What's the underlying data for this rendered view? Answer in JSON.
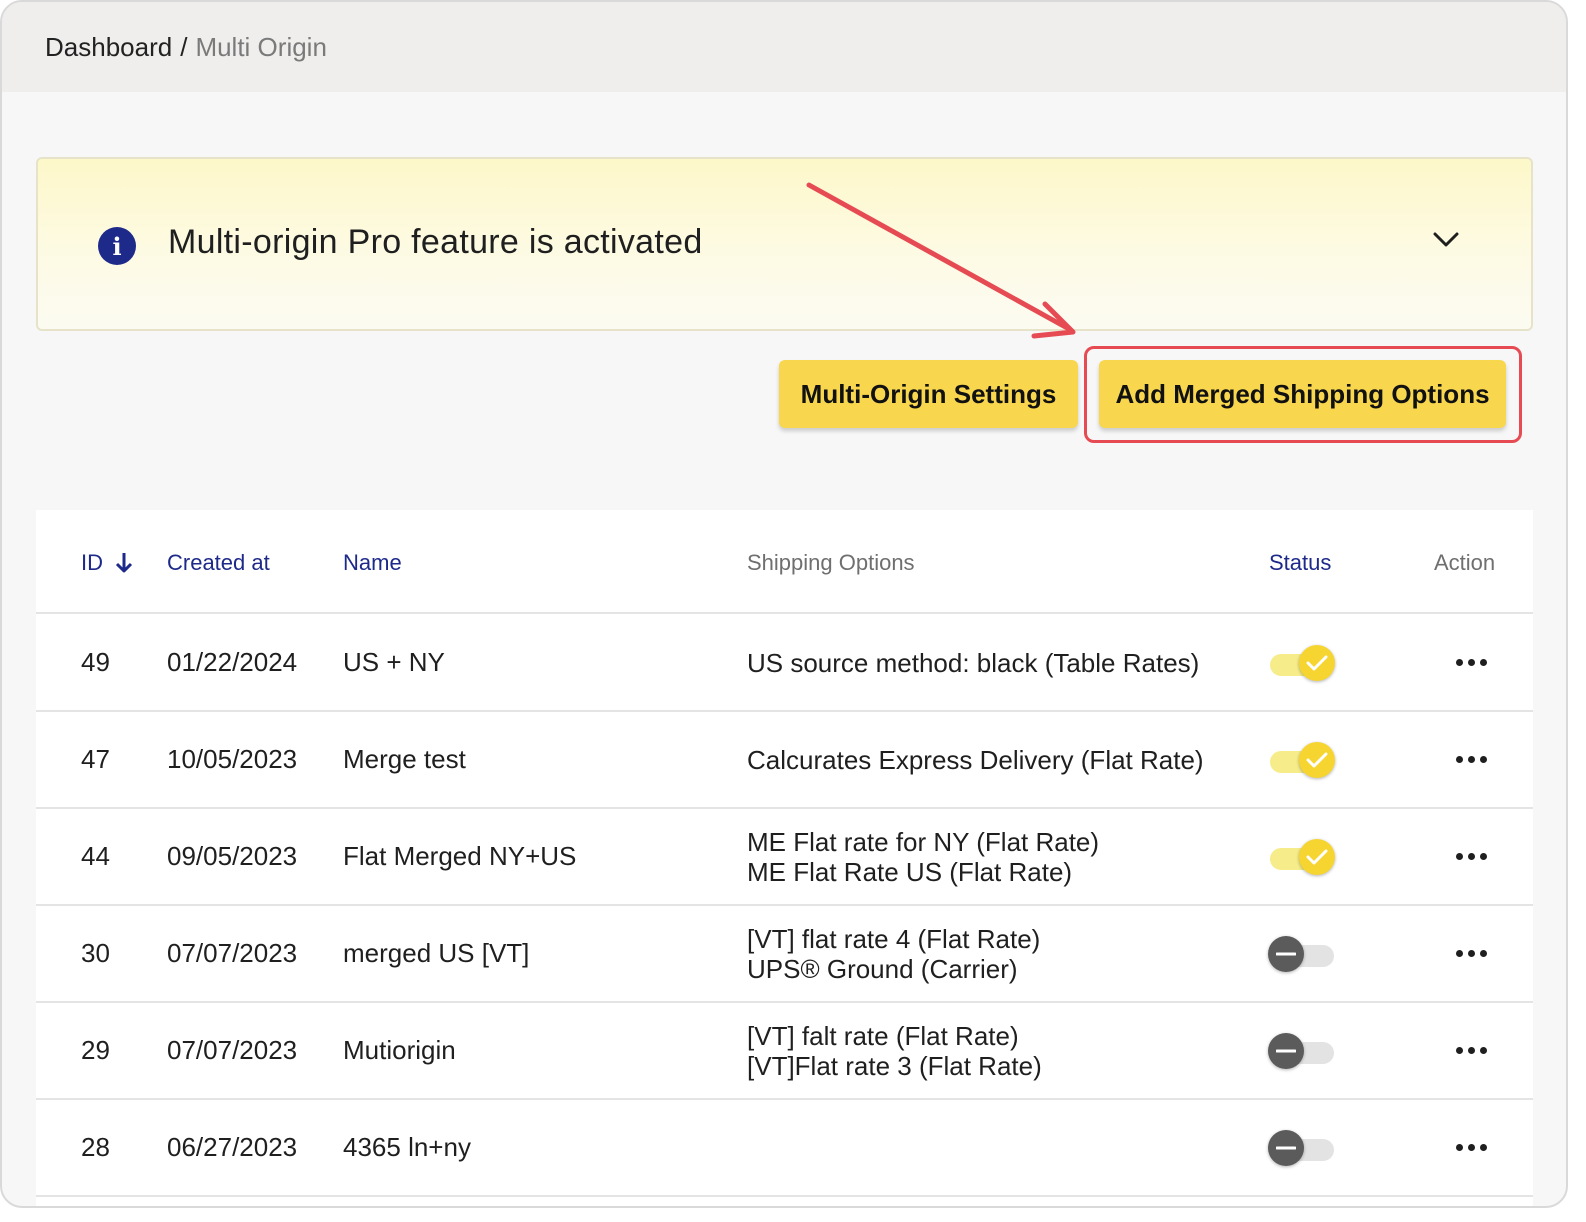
{
  "breadcrumb": {
    "home": "Dashboard",
    "separator": "/",
    "current": "Multi Origin"
  },
  "banner": {
    "icon": "info-icon",
    "message": "Multi-origin Pro feature is activated",
    "toggle_icon": "chevron-down-icon"
  },
  "actions": {
    "settings_label": "Multi-Origin Settings",
    "add_label": "Add Merged Shipping Options"
  },
  "colors": {
    "button": "#f8d64e",
    "highlight": "#e64b53",
    "header_link": "#1e2a8a",
    "toggle_on": "#f7d531",
    "toggle_off": "#5b5b5b"
  },
  "table": {
    "headers": {
      "id": "ID",
      "created_at": "Created at",
      "name": "Name",
      "shipping_options": "Shipping Options",
      "status": "Status",
      "action": "Action"
    },
    "sort_icon": "arrow-down-icon",
    "rows": [
      {
        "id": "49",
        "created_at": "01/22/2024",
        "name": "US + NY",
        "shipping": [
          "US source method: black (Table Rates)"
        ],
        "status": "on"
      },
      {
        "id": "47",
        "created_at": "10/05/2023",
        "name": "Merge test",
        "shipping": [
          "Calcurates Express Delivery (Flat Rate)"
        ],
        "status": "on"
      },
      {
        "id": "44",
        "created_at": "09/05/2023",
        "name": "Flat Merged NY+US",
        "shipping": [
          "ME Flat rate for NY (Flat Rate)",
          "ME Flat Rate US (Flat Rate)"
        ],
        "status": "on"
      },
      {
        "id": "30",
        "created_at": "07/07/2023",
        "name": "merged US [VT]",
        "shipping": [
          "[VT] flat rate 4 (Flat Rate)",
          "UPS® Ground (Carrier)"
        ],
        "status": "off"
      },
      {
        "id": "29",
        "created_at": "07/07/2023",
        "name": "Mutiorigin",
        "shipping": [
          "[VT] falt rate (Flat Rate)",
          "[VT]Flat rate 3 (Flat Rate)"
        ],
        "status": "off"
      },
      {
        "id": "28",
        "created_at": "06/27/2023",
        "name": "4365 ln+ny",
        "shipping": [],
        "status": "off"
      }
    ]
  }
}
